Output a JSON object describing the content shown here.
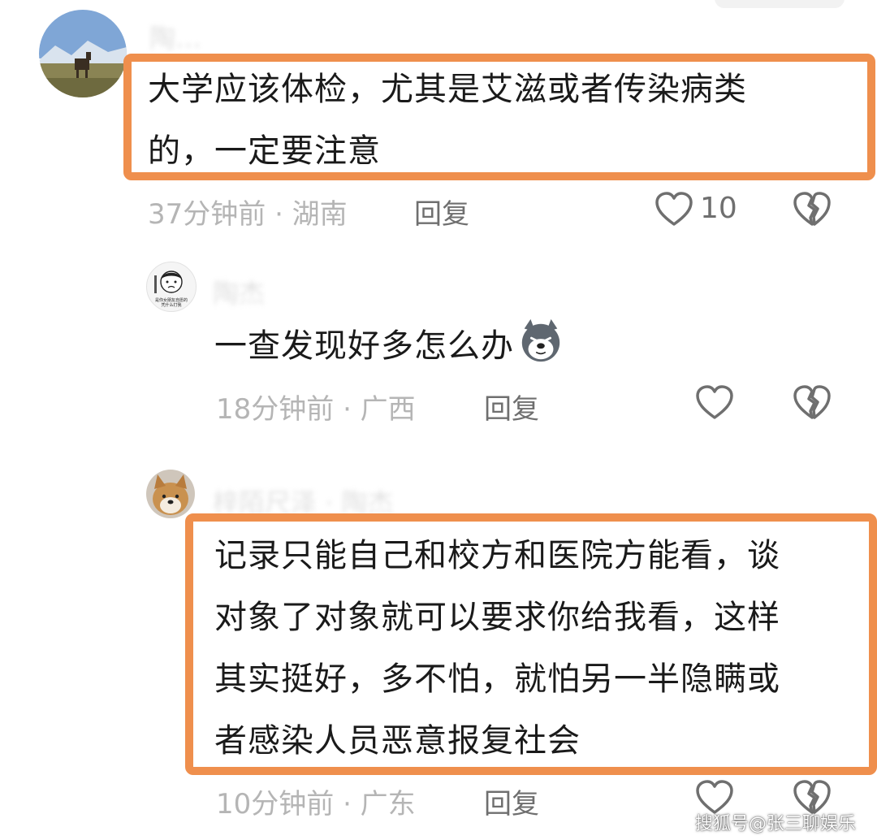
{
  "comments": [
    {
      "username": "陶…",
      "text_lines": [
        "大学应该体检，尤其是艾滋或者传染病类",
        "的，一定要注意"
      ],
      "time_location": "37分钟前 · 湖南",
      "reply_label": "回复",
      "like_count": "10"
    },
    {
      "username": "陶杰",
      "text_lines": [
        "一查发现好多怎么办"
      ],
      "time_location": "18分钟前 · 广西",
      "reply_label": "回复",
      "like_count": ""
    },
    {
      "username": "梓陌尺泽 · 陶杰",
      "text_lines": [
        "记录只能自己和校方和医院方能看，谈",
        "对象了对象就可以要求你给我看，这样",
        "其实挺好，多不怕，就怕另一半隐瞒或",
        "者感染人员恶意报复社会"
      ],
      "time_location": "10分钟前 · 广东",
      "reply_label": "回复",
      "like_count": ""
    }
  ],
  "avatar_caption": [
    "是你女朋友自愿的",
    "凭什么打我"
  ],
  "watermark": "搜狐号@张三聊娱乐",
  "highlight_color": "#ef8f4d",
  "icons": {
    "like": "heart-outline-icon",
    "dislike": "broken-heart-icon",
    "emoji": "husky-dog-emoji-icon"
  }
}
